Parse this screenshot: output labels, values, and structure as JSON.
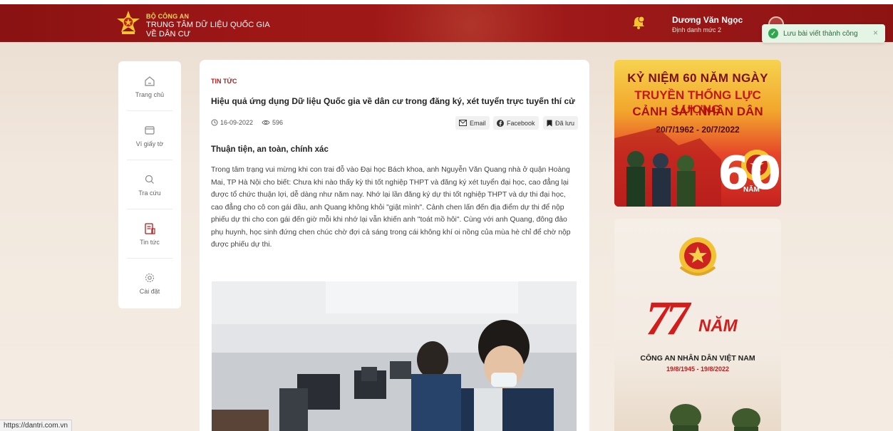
{
  "header": {
    "org": "BỘ CÔNG AN",
    "center_line1": "TRUNG TÂM DỮ LIỆU QUỐC GIA",
    "center_line2": "VỀ DÂN CƯ",
    "user_name": "Dương Văn Ngọc",
    "user_level": "Định danh mức 2",
    "notification_icon": "bell-icon"
  },
  "toast": {
    "message": "Lưu bài viết thành công",
    "close": "×"
  },
  "sidebar": {
    "items": [
      {
        "label": "Trang chủ",
        "icon": "home-icon"
      },
      {
        "label": "Ví giấy tờ",
        "icon": "wallet-icon"
      },
      {
        "label": "Tra cứu",
        "icon": "search-icon"
      },
      {
        "label": "Tin tức",
        "icon": "news-icon"
      },
      {
        "label": "Cài đặt",
        "icon": "gear-icon"
      }
    ]
  },
  "article": {
    "category": "TIN TỨC",
    "title": "Hiệu quả ứng dụng Dữ liệu Quốc gia về dân cư trong đăng ký, xét tuyển trực tuyến thí cử",
    "date": "16-09-2022",
    "views": "596",
    "share_email": "Email",
    "share_facebook": "Facebook",
    "saved": "Đã lưu",
    "subheading": "Thuận tiện, an toàn, chính xác",
    "body": "Trong tâm trạng vui mừng khi con trai đỗ vào Đại học Bách khoa, anh Nguyễn Văn Quang nhà ở quận Hoàng Mai, TP Hà Nội cho biết: Chưa khi nào thấy kỳ thi tốt nghiệp THPT và đăng ký xét tuyển đại học, cao đẳng lại được tổ chức thuận lợi, dễ dàng như năm nay. Nhớ lại lần đăng ký dự thi tốt nghiệp THPT và dự thi đại học, cao đẳng cho cô con gái đầu, anh Quang không khỏi \"giật mình\". Cảnh chen lấn đến địa điểm dự thi để nộp phiếu dự thi cho con gái đến giờ mỗi khi nhớ lại vẫn khiến anh \"toát mồ hôi\". Cùng với anh Quang, đông đảo phụ huynh, học sinh đứng chen chúc chờ đợi cả sáng trong cái không khí oi nồng của mùa hè chỉ để chờ nộp được phiếu dự thi."
  },
  "banner1": {
    "line1": "KỶ NIỆM 60 NĂM NGÀY",
    "line2": "TRUYỀN THỐNG LỰC LƯỢNG",
    "line3": "CẢNH SÁT NHÂN DÂN",
    "dates": "20/7/1962 - 20/7/2022",
    "number": "60",
    "nam": "NĂM"
  },
  "banner2": {
    "number": "77",
    "nam": "NĂM",
    "caption": "CÔNG AN NHÂN DÂN VIỆT NAM",
    "dates": "19/8/1945 - 19/8/2022"
  },
  "status_bar": {
    "url": "https://dantri.com.vn"
  },
  "colors": {
    "header": "#9e1717",
    "accent": "#b01e1e",
    "toast_bg": "#e4f5e6",
    "toast_check": "#2fa84f"
  }
}
